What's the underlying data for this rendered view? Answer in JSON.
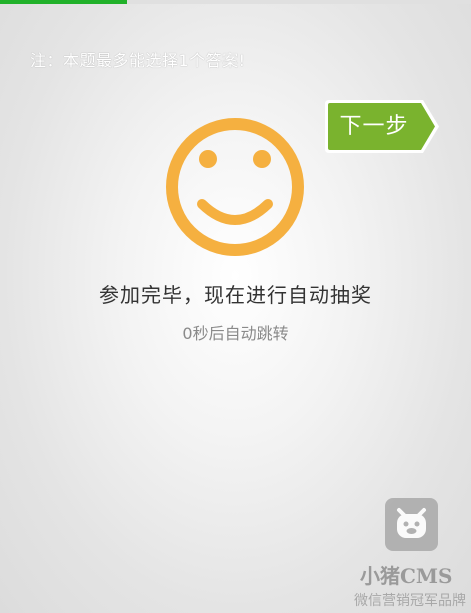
{
  "progress": {
    "fraction": 0.27,
    "color": "#21b12a"
  },
  "notice": {
    "text": "注：本题最多能选择1个答案!"
  },
  "next_button": {
    "label": "下一步",
    "color": "#7ab32e"
  },
  "result": {
    "icon": "smiley-face-icon",
    "icon_color": "#f5b040",
    "title": "参加完毕，现在进行自动抽奖",
    "countdown": "0秒后自动跳转"
  },
  "watermark": {
    "logo_icon": "pig-face-icon",
    "brand": "小猪CMS",
    "slogan": "微信营销冠军品牌"
  }
}
